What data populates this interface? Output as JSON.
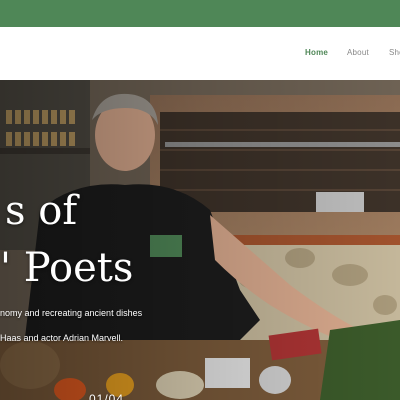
{
  "colors": {
    "top_bar": "#4f8757",
    "nav_active": "#4f8757",
    "nav_inactive": "#888888",
    "hero_text": "#ffffff"
  },
  "nav": {
    "items": [
      {
        "label": "Home",
        "active": true
      },
      {
        "label": "About",
        "active": false
      },
      {
        "label": "Sho",
        "active": false
      }
    ]
  },
  "hero": {
    "title_line1": "s of",
    "title_line2": "' Poets",
    "subtitle_line1": "nomy and recreating ancient dishes",
    "subtitle_line2": "Haas and actor Adrian Marvell.",
    "slide_counter": "01/04",
    "image_description_icon": "kitchen-photo"
  }
}
